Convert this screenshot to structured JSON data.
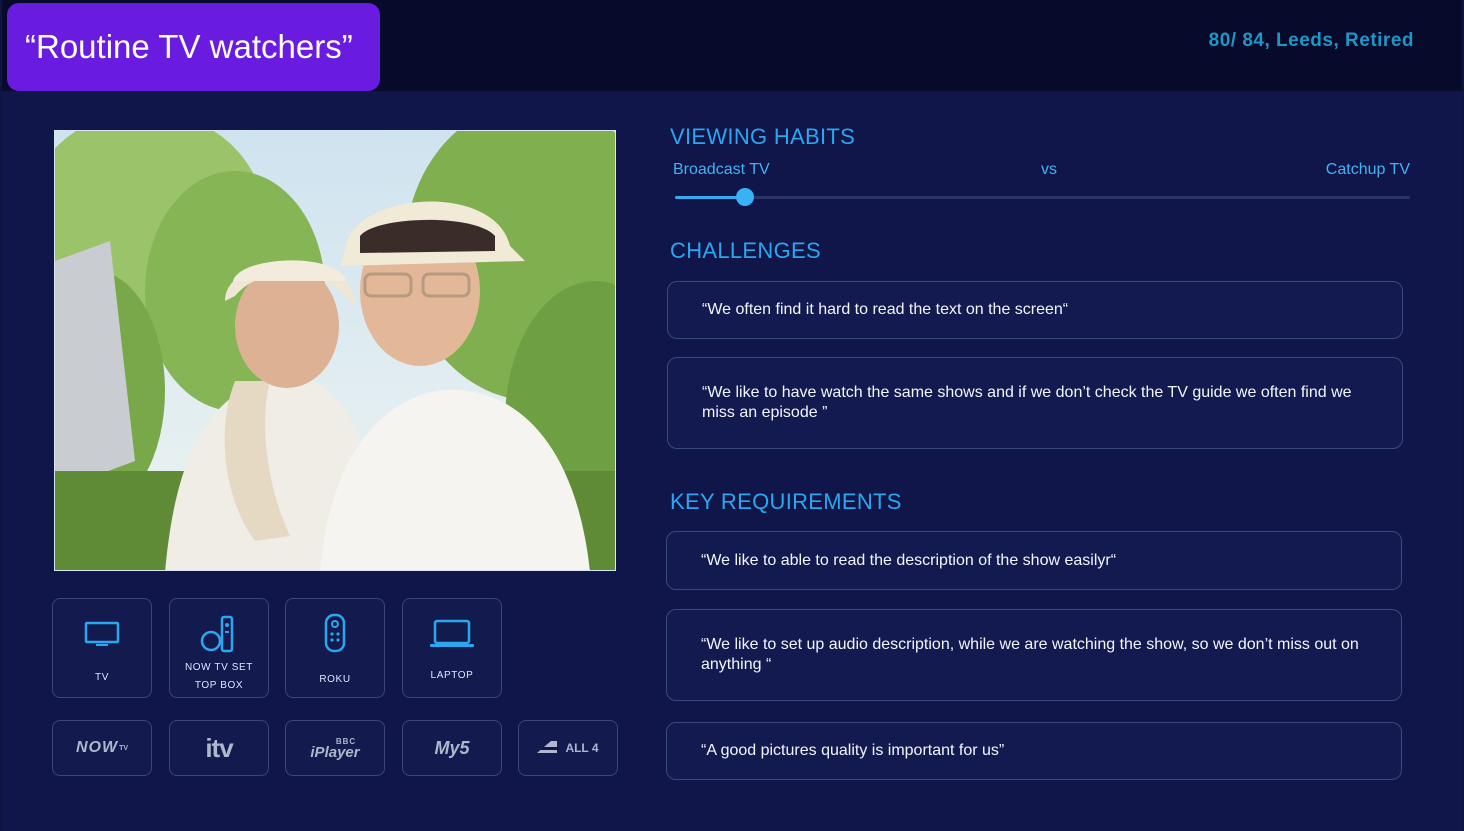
{
  "header": {
    "title": "“Routine TV watchers”",
    "meta": "80/ 84, Leeds, Retired"
  },
  "viewing_habits": {
    "heading": "VIEWING HABITS",
    "left_label": "Broadcast TV",
    "middle_label": "vs",
    "right_label": "Catchup TV",
    "slider_value_fraction": 0.095
  },
  "challenges": {
    "heading": "CHALLENGES",
    "quotes": [
      "“We often find it hard to read the text on the screen“",
      "“We like to have watch the same shows and if we don’t check the TV guide we often find we miss an episode ”"
    ]
  },
  "requirements": {
    "heading": "KEY REQUIREMENTS",
    "quotes": [
      "“We like to able to read the description of the show easilyr“",
      "“We like to set up audio description, while we are watching the show, so we don’t miss out on anything “",
      "“A good pictures quality is important for us”"
    ]
  },
  "devices": [
    {
      "label": "TV",
      "icon": "tv-icon"
    },
    {
      "label": "NOW TV SET TOP BOX",
      "icon": "set-top-box-icon"
    },
    {
      "label": "ROKU",
      "icon": "remote-icon"
    },
    {
      "label": "LAPTOP",
      "icon": "laptop-icon"
    }
  ],
  "services": [
    {
      "label": "NOW",
      "superscript": "TV",
      "icon": "now-tv-logo"
    },
    {
      "label": "itv",
      "icon": "itv-logo"
    },
    {
      "label": "iPlayer",
      "superscript": "BBC",
      "icon": "bbc-iplayer-logo"
    },
    {
      "label": "My5",
      "icon": "my5-logo"
    },
    {
      "label": "ALL 4",
      "icon": "all4-logo"
    }
  ],
  "colors": {
    "background": "#10154a",
    "topbar": "#070a2a",
    "title_pill": "#6a1be0",
    "accent": "#2aa7ee"
  }
}
